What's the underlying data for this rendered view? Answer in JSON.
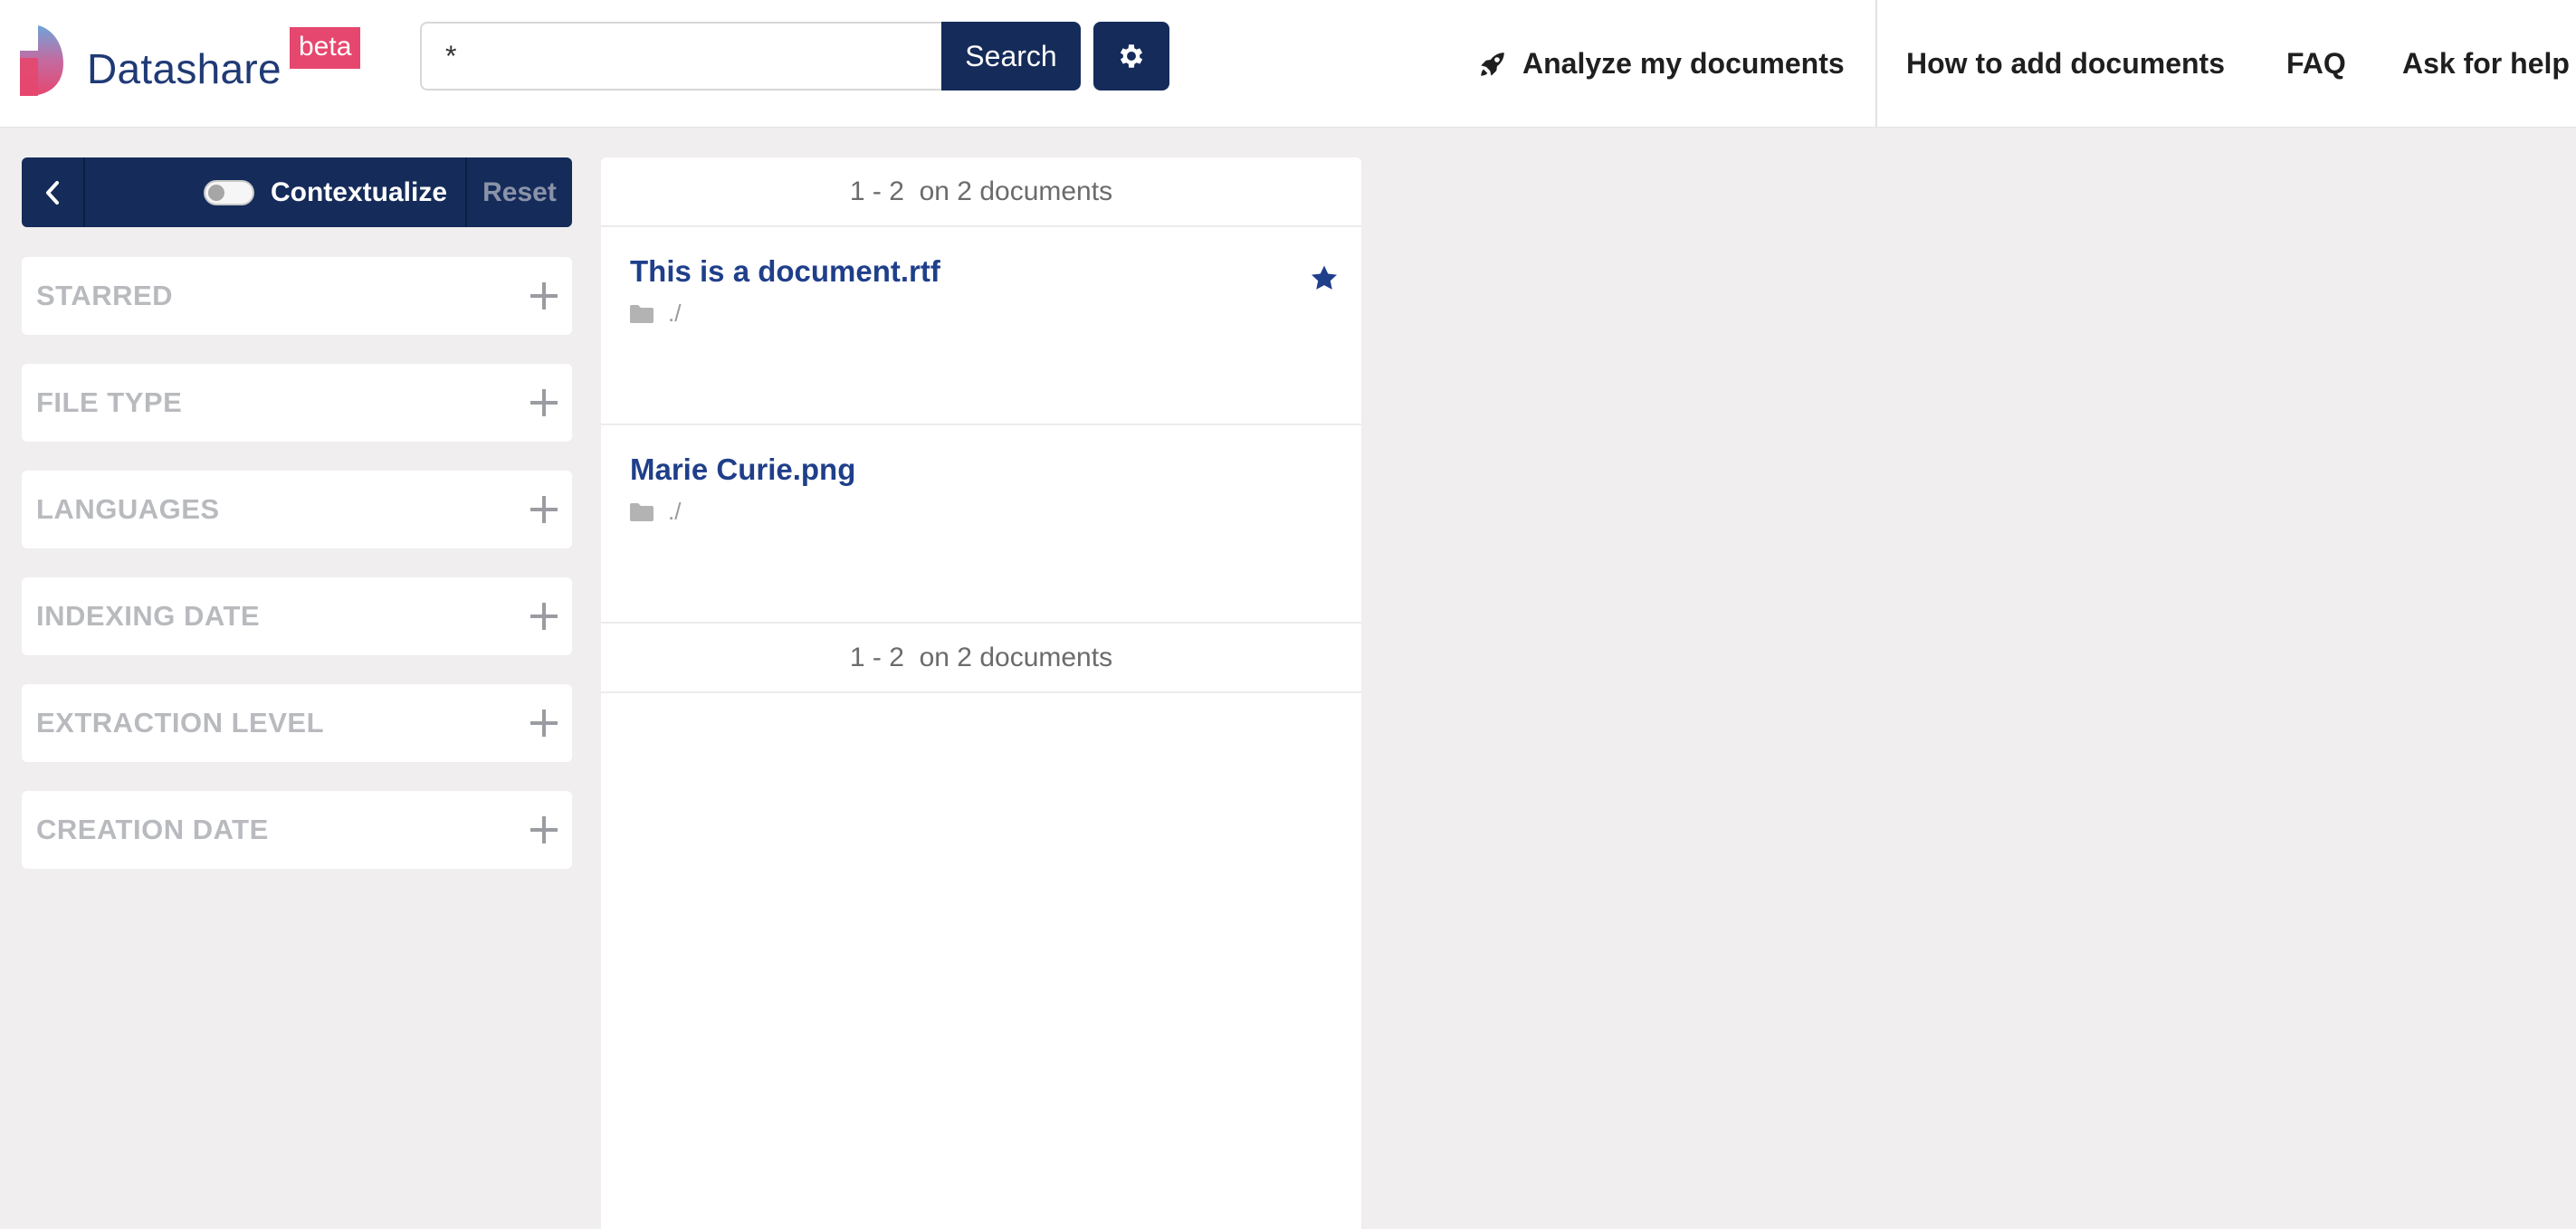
{
  "header": {
    "brand_name": "Datashare",
    "beta_label": "beta",
    "search": {
      "value": "*",
      "button_label": "Search"
    },
    "settings_icon": "gear-icon",
    "nav": [
      {
        "label": "Analyze my documents",
        "icon": "rocket-icon"
      },
      {
        "label": "How to add documents"
      },
      {
        "label": "FAQ"
      },
      {
        "label": "Ask for help"
      }
    ]
  },
  "sidebar": {
    "toolbar": {
      "back_icon": "chevron-left-icon",
      "contextualize_label": "Contextualize",
      "contextualize_on": false,
      "reset_label": "Reset"
    },
    "filters": [
      {
        "label": "STARRED"
      },
      {
        "label": "FILE TYPE"
      },
      {
        "label": "LANGUAGES"
      },
      {
        "label": "INDEXING DATE"
      },
      {
        "label": "EXTRACTION LEVEL"
      },
      {
        "label": "CREATION DATE"
      }
    ]
  },
  "results": {
    "pager_text": "1 - 2  on 2 documents",
    "documents": [
      {
        "title": "This is a document.rtf",
        "path": "./",
        "starred": true
      },
      {
        "title": "Marie Curie.png",
        "path": "./",
        "starred": false
      }
    ]
  },
  "colors": {
    "brand_navy": "#152b5a",
    "beta_pink": "#e6476e",
    "link_blue": "#1f3f8a",
    "background": "#f0eeef"
  }
}
